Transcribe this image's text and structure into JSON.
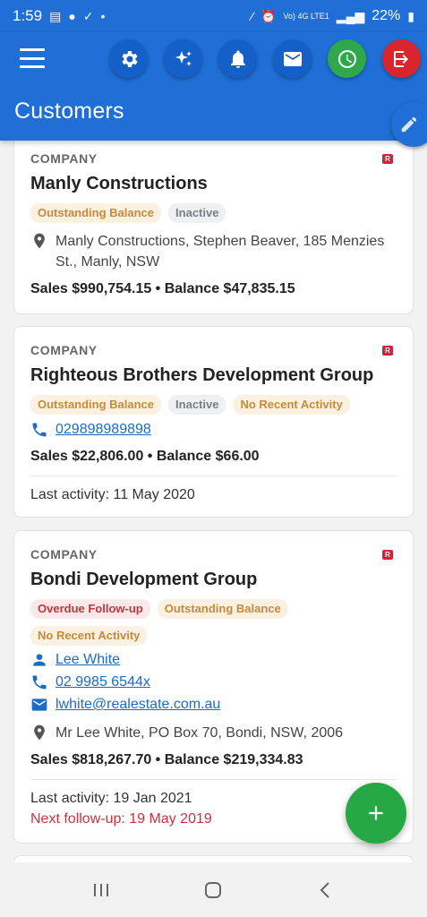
{
  "status_bar": {
    "time": "1:59",
    "network": "Vo) 4G LTE1",
    "battery": "22%"
  },
  "header": {
    "title": "Customers"
  },
  "customers": [
    {
      "type": "COMPANY",
      "badge": "R",
      "name": "Manly Constructions",
      "tags": [
        "Outstanding Balance",
        "Inactive"
      ],
      "address": "Manly Constructions, Stephen Beaver, 185 Menzies St., Manly, NSW",
      "totals": "Sales $990,754.15 • Balance $47,835.15"
    },
    {
      "type": "COMPANY",
      "badge": "R",
      "name": "Righteous Brothers Development Group",
      "tags": [
        "Outstanding Balance",
        "Inactive",
        "No Recent Activity"
      ],
      "phone": "029898989898",
      "totals": "Sales $22,806.00 • Balance $66.00",
      "last_activity": "Last activity: 11 May 2020"
    },
    {
      "type": "COMPANY",
      "badge": "R",
      "name": "Bondi Development Group",
      "tags": [
        "Overdue Follow-up",
        "Outstanding Balance",
        "No Recent Activity"
      ],
      "contact": "Lee White",
      "phone": "02 9985 6544x",
      "email": "lwhite@realestate.com.au",
      "address": "Mr Lee White, PO Box 70, Bondi, NSW, 2006",
      "totals": "Sales $818,267.70 • Balance $219,334.83",
      "last_activity": "Last activity: 19 Jan 2021",
      "next_followup": "Next follow-up: 19 May 2019"
    }
  ],
  "colors": {
    "primary": "#1f6fd6",
    "fab_green": "#26a845",
    "logout_red": "#d9262c",
    "link_blue": "#1a6cc7"
  }
}
